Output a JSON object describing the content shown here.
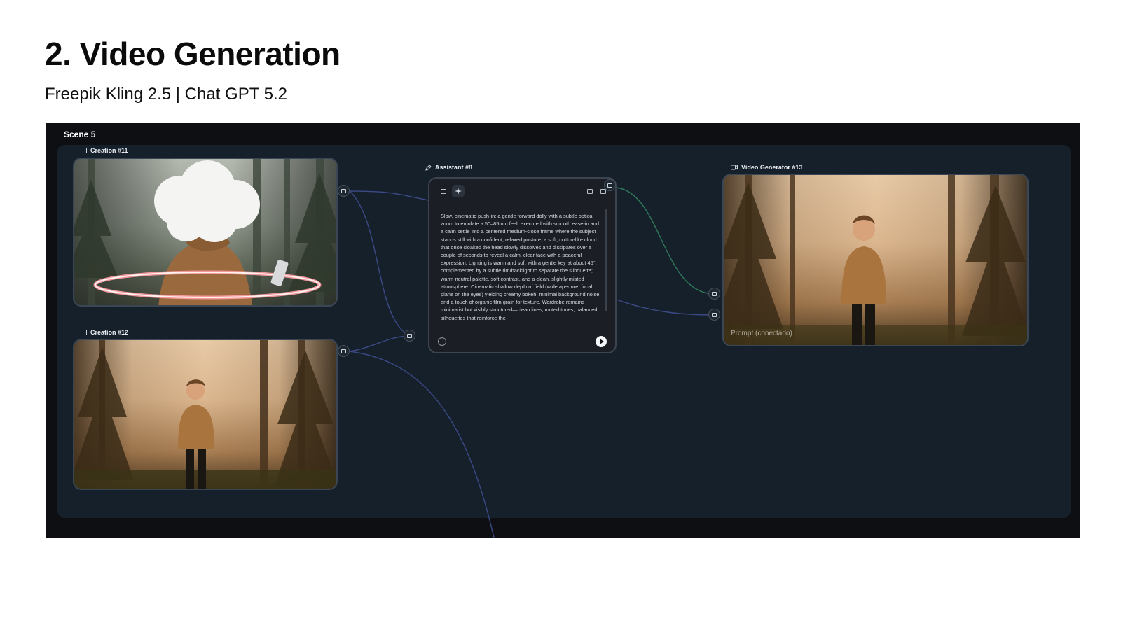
{
  "slide": {
    "title": "2. Video Generation",
    "subtitle": "Freepik Kling 2.5  | Chat GPT 5.2"
  },
  "canvas": {
    "scene_label": "Scene 5",
    "nodes": {
      "creation_11": {
        "title": "Creation #11",
        "icon": "image-icon"
      },
      "creation_12": {
        "title": "Creation #12",
        "icon": "image-icon"
      },
      "assistant_8": {
        "title": "Assistant #8",
        "icon": "pencil-icon",
        "text": "Slow, cinematic push-in: a gentle forward dolly with a subtle optical zoom to emulate a 50–85mm feel, executed with smooth ease-in and a calm settle into a centered medium-close frame where the subject stands still with a confident, relaxed posture; a soft, cotton-like cloud that once cloaked the head slowly dissolves and dissipates over a couple of seconds to reveal a calm, clear face with a peaceful expression. Lighting is warm and soft with a gentle key at about 45°, complemented by a subtle rim/backlight to separate the silhouette; warm-neutral palette, soft contrast, and a clean, slightly misted atmosphere. Cinematic shallow depth of field (wide aperture, focal plane on the eyes) yielding creamy bokeh, minimal background noise, and a touch of organic film grain for texture. Wardrobe remains minimalist but visibly structured—clean lines, muted tones, balanced silhouettes that reinforce the"
      },
      "video_generator_13": {
        "title": "Video Generator #13",
        "icon": "video-icon",
        "prompt_label": "Prompt (conectado)"
      }
    },
    "colors": {
      "canvas_bg": "#0d0f13",
      "group_bg": "#16202b",
      "wire_blue": "#3b4a86",
      "wire_green": "#2f7a5a"
    }
  }
}
